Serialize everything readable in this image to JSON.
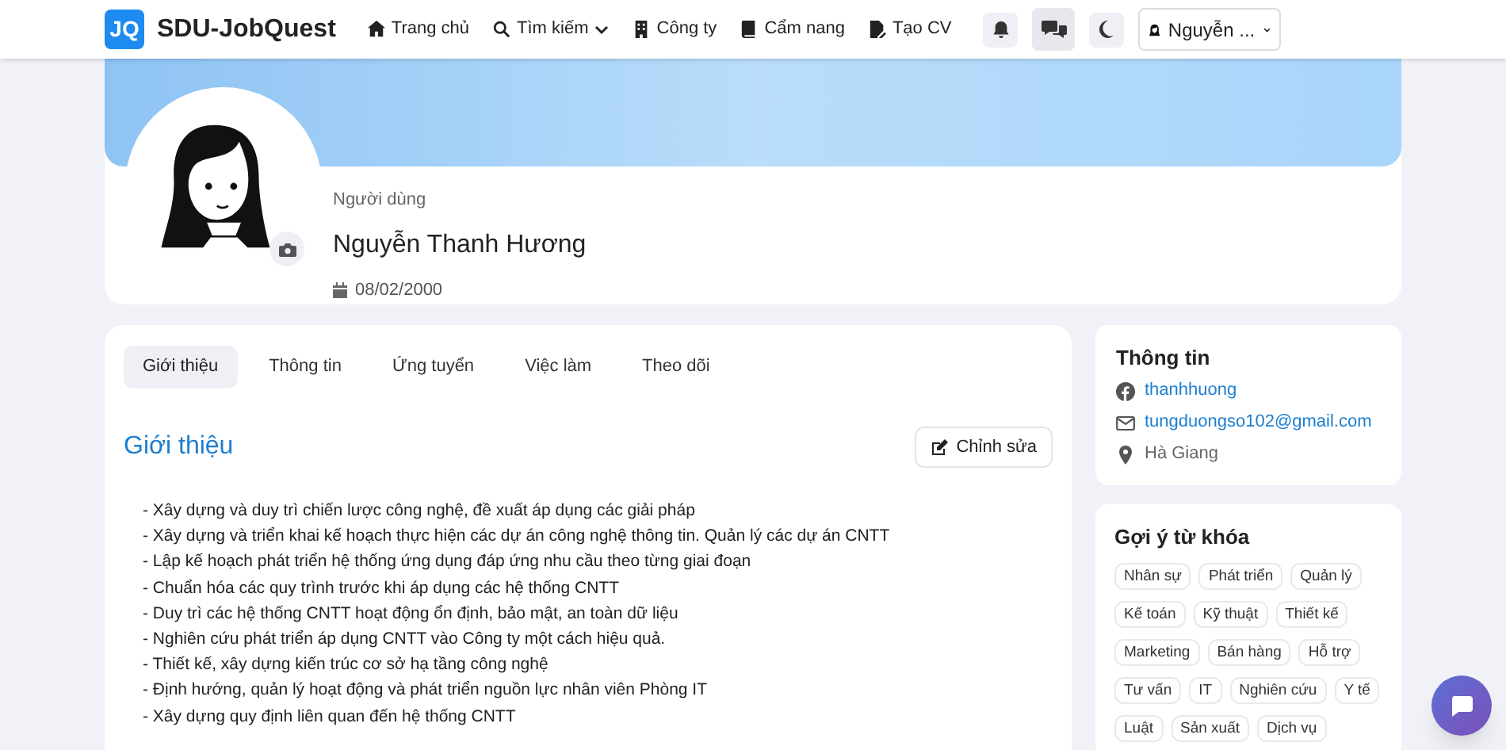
{
  "header": {
    "logo": "JQ",
    "brand": "SDU-JobQuest",
    "nav": [
      {
        "label": "Trang chủ",
        "kind": "home",
        "dropdown": false
      },
      {
        "label": "Tìm kiếm",
        "kind": "search",
        "dropdown": true
      },
      {
        "label": "Công ty",
        "kind": "company",
        "dropdown": false
      },
      {
        "label": "Cẩm nang",
        "kind": "book",
        "dropdown": false
      },
      {
        "label": "Tạo CV",
        "kind": "cv",
        "dropdown": false
      }
    ],
    "user": "Nguyễn ..."
  },
  "profile": {
    "role": "Người dùng",
    "name": "Nguyễn Thanh Hương",
    "birthday": "08/02/2000"
  },
  "tabs": [
    {
      "label": "Giới thiệu",
      "selected": true
    },
    {
      "label": "Thông tin",
      "selected": false
    },
    {
      "label": "Ứng tuyển",
      "selected": false
    },
    {
      "label": "Việc làm",
      "selected": false
    },
    {
      "label": "Theo dõi",
      "selected": false
    }
  ],
  "about": {
    "title": "Giới thiệu",
    "edit_button": "Chỉnh sửa",
    "lines": [
      "- Xây dựng và duy trì chiến lược công nghệ, đề xuất áp dụng các giải pháp",
      "- Xây dựng và triển khai kế hoạch thực hiện các dự án công nghệ thông tin. Quản lý các dự án CNTT",
      "- Lập kế hoạch phát triển hệ thống ứng dụng đáp ứng nhu cầu theo từng giai đoạn",
      "- Chuẩn hóa các quy trình trước khi áp dụng các hệ thống CNTT",
      "- Duy trì các hệ thống CNTT hoạt động ổn định, bảo mật, an toàn dữ liệu",
      "- Nghiên cứu phát triển áp dụng CNTT vào Công ty một cách hiệu quả.",
      "- Thiết kế, xây dựng kiến trúc cơ sở hạ tầng công nghệ",
      "- Định hướng, quản lý hoạt động và phát triển nguồn lực nhân viên Phòng IT",
      "- Xây dựng quy định liên quan đến hệ thống CNTT"
    ]
  },
  "info": {
    "title": "Thông tin",
    "items": [
      {
        "kind": "facebook",
        "text": "thanhhuong"
      },
      {
        "kind": "email",
        "text": "tungduongso102@gmail.com"
      },
      {
        "kind": "location",
        "text": "Hà Giang"
      }
    ]
  },
  "keywords": {
    "title": "Gợi ý từ khóa",
    "tags": [
      "Nhân sự",
      "Phát triển",
      "Quản lý",
      "Kế toán",
      "Kỹ thuật",
      "Thiết kế",
      "Marketing",
      "Bán hàng",
      "Hỗ trợ",
      "Tư vấn",
      "IT",
      "Nghiên cứu",
      "Y tế",
      "Luật",
      "Sản xuất",
      "Dịch vụ"
    ]
  }
}
